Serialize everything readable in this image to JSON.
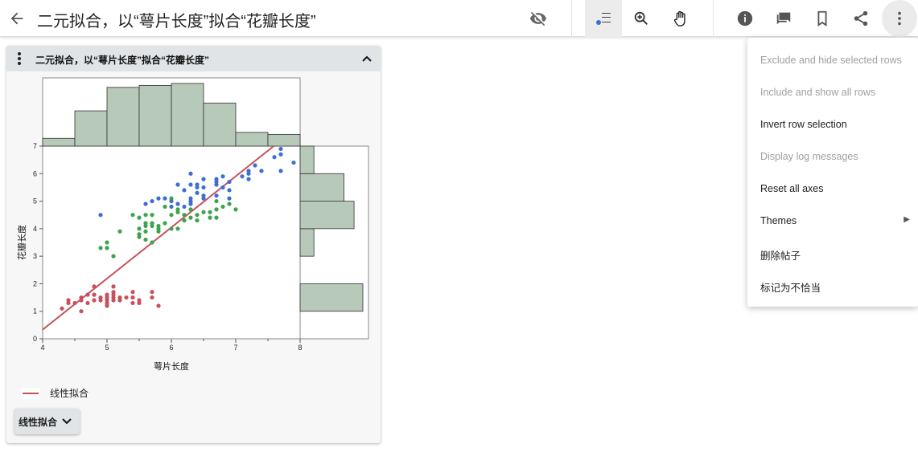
{
  "header": {
    "title": "二元拟合，以“萼片长度”拟合“花瓣长度”",
    "icons": [
      "back-arrow",
      "eye-off",
      "row-selection",
      "zoom-in",
      "hand-pan",
      "info",
      "comment",
      "bookmark",
      "share",
      "more-vert"
    ]
  },
  "card": {
    "title": "二元拟合，以“萼片长度”拟合“花瓣长度”",
    "legend_label": "线性拟合",
    "fit_button": "线性拟合"
  },
  "menu": {
    "items": [
      {
        "label": "Exclude and hide selected rows",
        "enabled": false
      },
      {
        "label": "Include and show all rows",
        "enabled": false
      },
      {
        "label": "Invert row selection",
        "enabled": true
      },
      {
        "label": "Display log messages",
        "enabled": false
      },
      {
        "label": "Reset all axes",
        "enabled": true
      },
      {
        "label": "Themes",
        "enabled": true,
        "submenu": true
      },
      {
        "label": "删除帖子",
        "enabled": true
      },
      {
        "label": "标记为不恰当",
        "enabled": true
      }
    ]
  },
  "chart_data": {
    "type": "scatter",
    "xlabel": "萼片长度",
    "ylabel": "花瓣长度",
    "xlim": [
      4,
      8
    ],
    "ylim": [
      0,
      7
    ],
    "xticks": [
      "4",
      "5",
      "6",
      "7",
      "8"
    ],
    "yticks": [
      "0",
      "1",
      "2",
      "3",
      "4",
      "5",
      "6",
      "7"
    ],
    "colors": {
      "group1": "#c8505a",
      "group2": "#3fa34d",
      "group3": "#3e6fd0",
      "fit": "#c8505a",
      "hist": "#b7c9b8"
    },
    "series": [
      {
        "color": "#c8505a",
        "points": [
          [
            4.3,
            1.1
          ],
          [
            4.4,
            1.4
          ],
          [
            4.4,
            1.3
          ],
          [
            4.5,
            1.3
          ],
          [
            4.6,
            1.0
          ],
          [
            4.6,
            1.4
          ],
          [
            4.6,
            1.5
          ],
          [
            4.7,
            1.3
          ],
          [
            4.7,
            1.6
          ],
          [
            4.8,
            1.4
          ],
          [
            4.8,
            1.6
          ],
          [
            4.8,
            1.9
          ],
          [
            4.9,
            1.4
          ],
          [
            4.9,
            1.5
          ],
          [
            5.0,
            1.2
          ],
          [
            5.0,
            1.3
          ],
          [
            5.0,
            1.4
          ],
          [
            5.0,
            1.5
          ],
          [
            5.0,
            1.6
          ],
          [
            5.1,
            1.4
          ],
          [
            5.1,
            1.5
          ],
          [
            5.1,
            1.6
          ],
          [
            5.1,
            1.7
          ],
          [
            5.1,
            1.9
          ],
          [
            5.2,
            1.4
          ],
          [
            5.2,
            1.5
          ],
          [
            5.3,
            1.5
          ],
          [
            5.4,
            1.3
          ],
          [
            5.4,
            1.5
          ],
          [
            5.4,
            1.7
          ],
          [
            5.5,
            1.3
          ],
          [
            5.5,
            1.4
          ],
          [
            5.7,
            1.5
          ],
          [
            5.7,
            1.7
          ],
          [
            5.8,
            1.2
          ]
        ]
      },
      {
        "color": "#3fa34d",
        "points": [
          [
            4.9,
            3.3
          ],
          [
            5.0,
            3.3
          ],
          [
            5.0,
            3.5
          ],
          [
            5.1,
            3.0
          ],
          [
            5.2,
            3.9
          ],
          [
            5.4,
            4.5
          ],
          [
            5.5,
            3.7
          ],
          [
            5.5,
            3.8
          ],
          [
            5.5,
            4.0
          ],
          [
            5.5,
            4.4
          ],
          [
            5.6,
            3.6
          ],
          [
            5.6,
            3.9
          ],
          [
            5.6,
            4.1
          ],
          [
            5.6,
            4.2
          ],
          [
            5.6,
            4.5
          ],
          [
            5.7,
            3.5
          ],
          [
            5.7,
            4.1
          ],
          [
            5.7,
            4.2
          ],
          [
            5.7,
            4.5
          ],
          [
            5.8,
            3.9
          ],
          [
            5.8,
            4.0
          ],
          [
            5.8,
            4.1
          ],
          [
            5.9,
            4.2
          ],
          [
            5.9,
            4.8
          ],
          [
            6.0,
            4.0
          ],
          [
            6.0,
            4.5
          ],
          [
            6.0,
            5.1
          ],
          [
            6.1,
            4.0
          ],
          [
            6.1,
            4.6
          ],
          [
            6.1,
            4.7
          ],
          [
            6.2,
            4.3
          ],
          [
            6.2,
            4.5
          ],
          [
            6.3,
            4.4
          ],
          [
            6.3,
            4.7
          ],
          [
            6.4,
            4.3
          ],
          [
            6.4,
            4.5
          ],
          [
            6.5,
            4.6
          ],
          [
            6.6,
            4.4
          ],
          [
            6.6,
            4.6
          ],
          [
            6.7,
            4.4
          ],
          [
            6.7,
            4.7
          ],
          [
            6.7,
            5.0
          ],
          [
            6.8,
            4.8
          ],
          [
            6.9,
            4.9
          ],
          [
            7.0,
            4.7
          ]
        ]
      },
      {
        "color": "#3e6fd0",
        "points": [
          [
            4.9,
            4.5
          ],
          [
            5.6,
            4.9
          ],
          [
            5.7,
            5.0
          ],
          [
            5.8,
            5.1
          ],
          [
            5.9,
            5.1
          ],
          [
            6.0,
            4.8
          ],
          [
            6.0,
            5.0
          ],
          [
            6.1,
            4.9
          ],
          [
            6.1,
            5.6
          ],
          [
            6.2,
            4.8
          ],
          [
            6.2,
            5.4
          ],
          [
            6.3,
            4.9
          ],
          [
            6.3,
            5.0
          ],
          [
            6.3,
            5.1
          ],
          [
            6.3,
            5.6
          ],
          [
            6.3,
            6.0
          ],
          [
            6.4,
            5.3
          ],
          [
            6.4,
            5.5
          ],
          [
            6.4,
            5.6
          ],
          [
            6.5,
            5.1
          ],
          [
            6.5,
            5.2
          ],
          [
            6.5,
            5.5
          ],
          [
            6.5,
            5.8
          ],
          [
            6.7,
            5.2
          ],
          [
            6.7,
            5.6
          ],
          [
            6.7,
            5.7
          ],
          [
            6.7,
            5.8
          ],
          [
            6.8,
            5.5
          ],
          [
            6.8,
            5.9
          ],
          [
            6.9,
            5.1
          ],
          [
            6.9,
            5.4
          ],
          [
            6.9,
            5.7
          ],
          [
            7.1,
            5.9
          ],
          [
            7.2,
            5.8
          ],
          [
            7.2,
            6.0
          ],
          [
            7.2,
            6.1
          ],
          [
            7.3,
            6.3
          ],
          [
            7.4,
            6.1
          ],
          [
            7.6,
            6.6
          ],
          [
            7.7,
            6.1
          ],
          [
            7.7,
            6.7
          ],
          [
            7.7,
            6.9
          ],
          [
            7.9,
            6.4
          ]
        ]
      }
    ],
    "fit_line": {
      "intercept": -7.101,
      "slope": 1.858
    },
    "x_histogram": {
      "bin_edges": [
        4,
        4.5,
        5,
        5.5,
        6,
        6.5,
        7,
        7.5,
        8
      ],
      "counts": [
        4,
        18,
        30,
        31,
        32,
        22,
        7,
        6
      ]
    },
    "y_histogram": {
      "bin_edges": [
        1,
        2,
        3,
        4,
        5,
        6,
        7
      ],
      "counts": [
        50,
        0,
        11,
        43,
        35,
        11
      ]
    }
  }
}
